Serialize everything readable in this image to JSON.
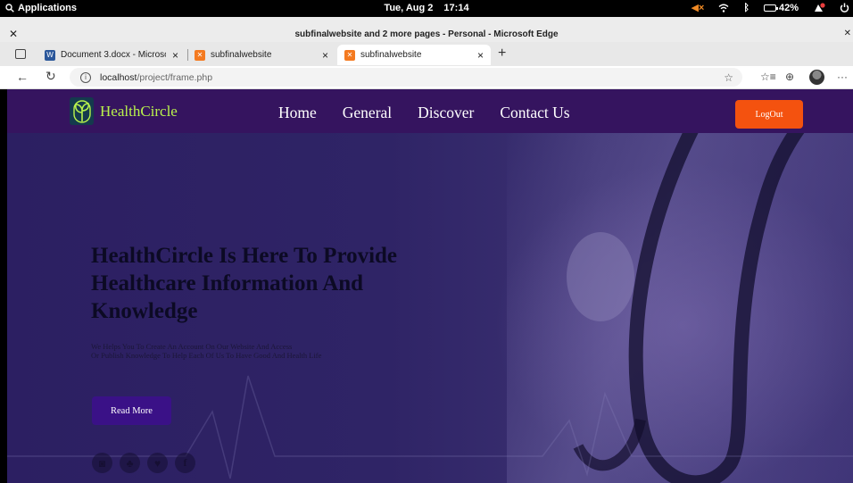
{
  "system_bar": {
    "applications": "Applications",
    "date": "Tue, Aug 2",
    "time": "17:14",
    "battery": "42%"
  },
  "window": {
    "title": "subfinalwebsite and 2 more pages - Personal - Microsoft Edge"
  },
  "tabs": [
    {
      "label": "Document 3.docx - Microsoft W"
    },
    {
      "label": "subfinalwebsite"
    },
    {
      "label": "subfinalwebsite"
    }
  ],
  "address": {
    "host": "localhost",
    "path": "/project/frame.php"
  },
  "site": {
    "brand": "HealthCircle",
    "nav": [
      "Home",
      "General",
      "Discover",
      "Contact Us"
    ],
    "logout_label": "LogOut",
    "headline": "HealthCircle Is Here To Provide Healthcare Information And Knowledge",
    "subtext_line1": "We Helps You To Create An Account On Our Website And Access",
    "subtext_line2": "Or Publish Knowledge To Help Each Of Us To Have Good And Health Life",
    "read_more_label": "Read More",
    "socials": [
      "instagram-icon",
      "snapchat-icon",
      "twitter-icon",
      "facebook-icon"
    ]
  },
  "colors": {
    "nav_bg": "#35145f",
    "brand_text": "#b9f34c",
    "logout_bg": "#f4520f",
    "read_more_bg": "#3a1187"
  }
}
